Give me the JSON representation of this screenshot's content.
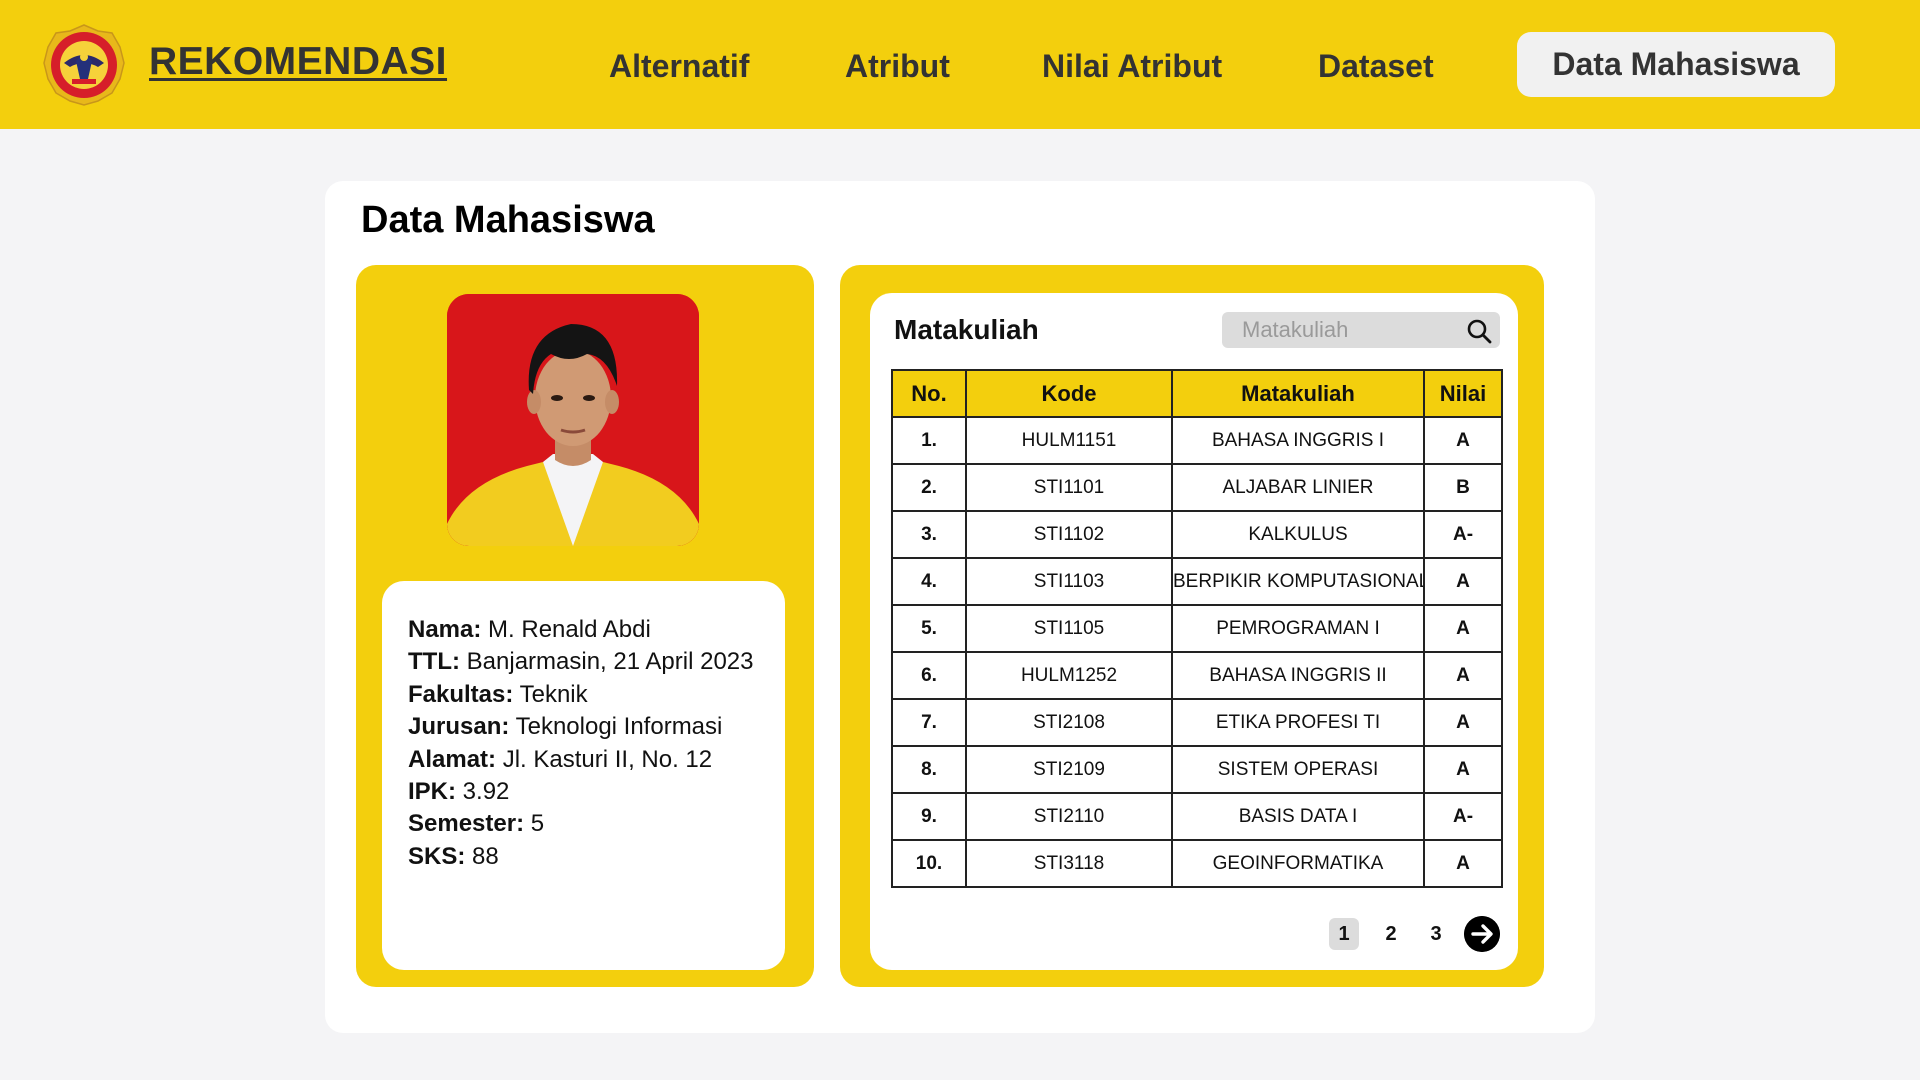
{
  "header": {
    "brand": "REKOMENDASI",
    "nav": {
      "alternatif": "Alternatif",
      "atribut": "Atribut",
      "nilai_atribut": "Nilai Atribut",
      "dataset": "Dataset",
      "active": "Data Mahasiswa"
    }
  },
  "page": {
    "title": "Data Mahasiswa"
  },
  "profile": {
    "fields": [
      {
        "label": "Nama:",
        "value": "M. Renald Abdi"
      },
      {
        "label": "TTL:",
        "value": "Banjarmasin, 21 April 2023"
      },
      {
        "label": "Fakultas:",
        "value": "Teknik"
      },
      {
        "label": "Jurusan:",
        "value": "Teknologi Informasi"
      },
      {
        "label": "Alamat:",
        "value": "Jl. Kasturi II, No. 12"
      },
      {
        "label": "IPK:",
        "value": "3.92"
      },
      {
        "label": "Semester:",
        "value": "5"
      },
      {
        "label": "SKS:",
        "value": "88"
      }
    ]
  },
  "courses": {
    "title": "Matakuliah",
    "search_placeholder": "Matakuliah",
    "headers": {
      "no": "No.",
      "kode": "Kode",
      "matakuliah": "Matakuliah",
      "nilai": "Nilai"
    },
    "rows": [
      {
        "no": "1.",
        "kode": "HULM1151",
        "matakuliah": "BAHASA INGGRIS I",
        "nilai": "A"
      },
      {
        "no": "2.",
        "kode": "STI1101",
        "matakuliah": "ALJABAR LINIER",
        "nilai": "B"
      },
      {
        "no": "3.",
        "kode": "STI1102",
        "matakuliah": "KALKULUS",
        "nilai": "A-"
      },
      {
        "no": "4.",
        "kode": "STI1103",
        "matakuliah": "BERPIKIR KOMPUTASIONAL",
        "nilai": "A"
      },
      {
        "no": "5.",
        "kode": "STI1105",
        "matakuliah": "PEMROGRAMAN I",
        "nilai": "A"
      },
      {
        "no": "6.",
        "kode": "HULM1252",
        "matakuliah": "BAHASA INGGRIS II",
        "nilai": "A"
      },
      {
        "no": "7.",
        "kode": "STI2108",
        "matakuliah": "ETIKA PROFESI TI",
        "nilai": "A"
      },
      {
        "no": "8.",
        "kode": "STI2109",
        "matakuliah": "SISTEM OPERASI",
        "nilai": "A"
      },
      {
        "no": "9.",
        "kode": "STI2110",
        "matakuliah": "BASIS DATA I",
        "nilai": "A-"
      },
      {
        "no": "10.",
        "kode": "STI3118",
        "matakuliah": "GEOINFORMATIKA",
        "nilai": "A"
      }
    ],
    "pagination": {
      "pages": [
        "1",
        "2",
        "3"
      ],
      "current": "1",
      "next_icon": "arrow-right-circle-icon"
    }
  },
  "icons": {
    "logo": "university-seal-logo",
    "search": "search-icon"
  },
  "colors": {
    "accent": "#f3cf0d",
    "photo_background": "#d8161a",
    "panel": "#ffffff"
  }
}
